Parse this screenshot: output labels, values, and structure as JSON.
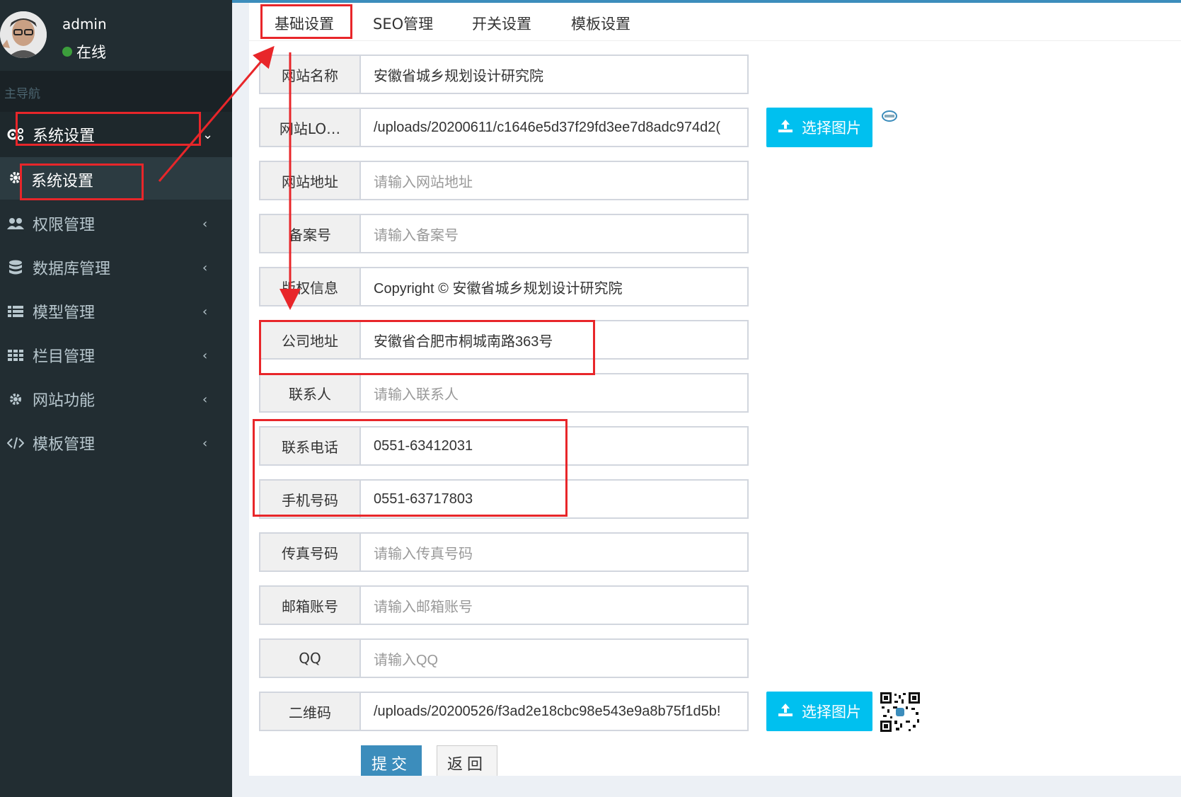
{
  "user": {
    "name": "admin",
    "status": "在线"
  },
  "sidebar": {
    "header": "主导航",
    "active_item": {
      "label": "系统设置",
      "icon": "gears-icon"
    },
    "sub_item": {
      "label": "系统设置",
      "icon": "gear-icon"
    },
    "items": [
      {
        "label": "权限管理",
        "icon": "users-icon"
      },
      {
        "label": "数据库管理",
        "icon": "database-icon"
      },
      {
        "label": "模型管理",
        "icon": "list-icon"
      },
      {
        "label": "栏目管理",
        "icon": "grid-icon"
      },
      {
        "label": "网站功能",
        "icon": "gear-icon"
      },
      {
        "label": "模板管理",
        "icon": "code-icon"
      }
    ]
  },
  "tabs": [
    "基础设置",
    "SEO管理",
    "开关设置",
    "模板设置"
  ],
  "form": {
    "rows": [
      {
        "label": "网站名称",
        "value": "安徽省城乡规划设计研究院",
        "placeholder": ""
      },
      {
        "label": "网站LO…",
        "value": "/uploads/20200611/c1646e5d37f29fd3ee7d8adc974d2(",
        "placeholder": ""
      },
      {
        "label": "网站地址",
        "value": "",
        "placeholder": "请输入网站地址"
      },
      {
        "label": "备案号",
        "value": "",
        "placeholder": "请输入备案号"
      },
      {
        "label": "版权信息",
        "value": "Copyright © 安徽省城乡规划设计研究院",
        "placeholder": ""
      },
      {
        "label": "公司地址",
        "value": "安徽省合肥市桐城南路363号",
        "placeholder": ""
      },
      {
        "label": "联系人",
        "value": "",
        "placeholder": "请输入联系人"
      },
      {
        "label": "联系电话",
        "value": "0551-63412031",
        "placeholder": ""
      },
      {
        "label": "手机号码",
        "value": "0551-63717803",
        "placeholder": ""
      },
      {
        "label": "传真号码",
        "value": "",
        "placeholder": "请输入传真号码"
      },
      {
        "label": "邮箱账号",
        "value": "",
        "placeholder": "请输入邮箱账号"
      },
      {
        "label": "QQ",
        "value": "",
        "placeholder": "请输入QQ"
      },
      {
        "label": "二维码",
        "value": "/uploads/20200526/f3ad2e18cbc98e543e9a8b75f1d5b!",
        "placeholder": ""
      }
    ],
    "upload_label": "选择图片",
    "submit_label": "提交",
    "back_label": "返回"
  },
  "colors": {
    "sidebar": "#222d32",
    "accent": "#3c8dbc",
    "upload": "#00c0ef",
    "annotation": "#e8262a"
  }
}
